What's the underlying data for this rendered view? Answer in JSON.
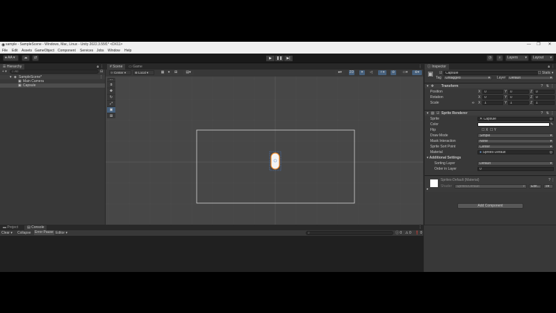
{
  "window": {
    "title": "sample - SampleScene - Windows, Mac, Linux - Unity 2022.3.55f1* <DX11>",
    "controls": [
      "—",
      "❐",
      "✕"
    ]
  },
  "menu": [
    "File",
    "Edit",
    "Assets",
    "GameObject",
    "Component",
    "Services",
    "Jobs",
    "Window",
    "Help"
  ],
  "toolbar": {
    "account": "AA",
    "layers": "Layers",
    "layout": "Layout"
  },
  "hierarchy": {
    "tab": "Hierarchy",
    "search_placeholder": "All",
    "scene": "SampleScene*",
    "items": [
      "Main Camera",
      "Capsule"
    ]
  },
  "scene": {
    "tabs": [
      "Scene",
      "Game"
    ],
    "pivot": "Center",
    "space": "Local",
    "view2d": "2D"
  },
  "inspector": {
    "tab": "Inspector",
    "object_name": "Capsule",
    "static": "Static",
    "tag_label": "Tag",
    "tag": "Untagged",
    "layer_label": "Layer",
    "layer": "Default",
    "transform": {
      "title": "Transform",
      "rows": [
        {
          "label": "Position",
          "x": "0",
          "y": "0",
          "z": "0"
        },
        {
          "label": "Rotation",
          "x": "0",
          "y": "0",
          "z": "0"
        },
        {
          "label": "Scale",
          "x": "1",
          "y": "1",
          "z": "1"
        }
      ],
      "axes": [
        "X",
        "Y",
        "Z"
      ]
    },
    "sprite_renderer": {
      "title": "Sprite Renderer",
      "sprite_label": "Sprite",
      "sprite": "Capsule",
      "color_label": "Color",
      "flip_label": "Flip",
      "flip_x": "X",
      "flip_y": "Y",
      "draw_mode_label": "Draw Mode",
      "draw_mode": "Simple",
      "mask_label": "Mask Interaction",
      "mask": "None",
      "sort_point_label": "Sprite Sort Point",
      "sort_point": "Center",
      "material_label": "Material",
      "material": "Sprites-Default",
      "additional": "Additional Settings",
      "sorting_layer_label": "Sorting Layer",
      "sorting_layer": "Default",
      "order_label": "Order in Layer",
      "order": "0"
    },
    "material_section": {
      "title": "Sprites-Default (Material)",
      "shader_label": "Shader",
      "shader": "Sprites/Default",
      "edit": "Edit..."
    },
    "add_component": "Add Component"
  },
  "bottom": {
    "tabs": [
      "Project",
      "Console"
    ],
    "clear": "Clear",
    "collapse": "Collapse",
    "error_pause": "Error Pause",
    "editor": "Editor",
    "counts": [
      "0",
      "0",
      "0"
    ]
  }
}
